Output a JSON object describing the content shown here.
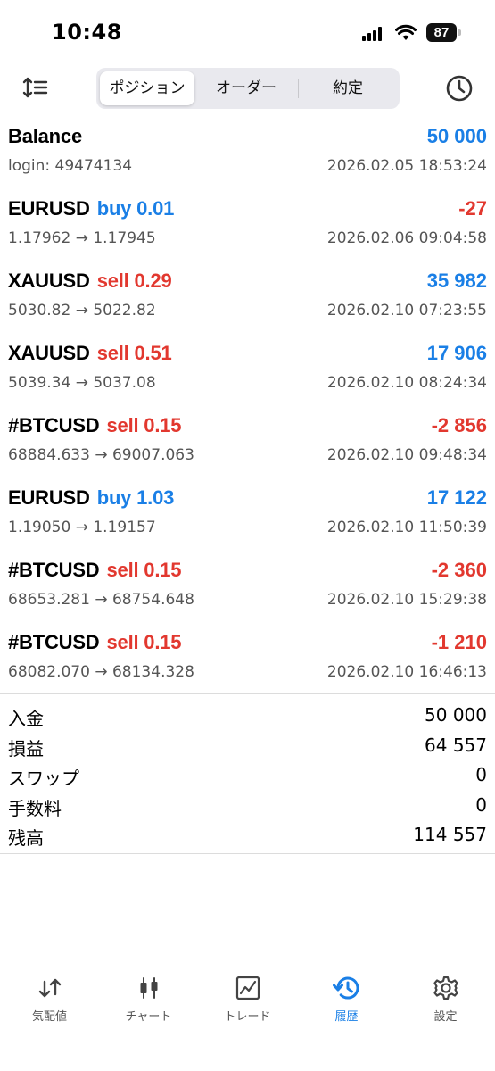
{
  "status_bar": {
    "time": "10:48",
    "battery": "87"
  },
  "toolbar": {
    "tabs": [
      {
        "label": "ポジション",
        "active": true
      },
      {
        "label": "オーダー",
        "active": false
      },
      {
        "label": "約定",
        "active": false
      }
    ]
  },
  "history": [
    {
      "symbol": "Balance",
      "side": "",
      "side_type": "",
      "value": "50 000",
      "value_type": "positive",
      "left_sub": "login: 49474134",
      "time": "2026.02.05 18:53:24"
    },
    {
      "symbol": "EURUSD",
      "side": "buy 0.01",
      "side_type": "buy",
      "value": "-27",
      "value_type": "negative",
      "left_sub": "1.17962 → 1.17945",
      "time": "2026.02.06 09:04:58"
    },
    {
      "symbol": "XAUUSD",
      "side": "sell 0.29",
      "side_type": "sell",
      "value": "35 982",
      "value_type": "positive",
      "left_sub": "5030.82 → 5022.82",
      "time": "2026.02.10 07:23:55"
    },
    {
      "symbol": "XAUUSD",
      "side": "sell 0.51",
      "side_type": "sell",
      "value": "17 906",
      "value_type": "positive",
      "left_sub": "5039.34 → 5037.08",
      "time": "2026.02.10 08:24:34"
    },
    {
      "symbol": "#BTCUSD",
      "side": "sell 0.15",
      "side_type": "sell",
      "value": "-2 856",
      "value_type": "negative",
      "left_sub": "68884.633 → 69007.063",
      "time": "2026.02.10 09:48:34"
    },
    {
      "symbol": "EURUSD",
      "side": "buy 1.03",
      "side_type": "buy",
      "value": "17 122",
      "value_type": "positive",
      "left_sub": "1.19050 → 1.19157",
      "time": "2026.02.10 11:50:39"
    },
    {
      "symbol": "#BTCUSD",
      "side": "sell 0.15",
      "side_type": "sell",
      "value": "-2 360",
      "value_type": "negative",
      "left_sub": "68653.281 → 68754.648",
      "time": "2026.02.10 15:29:38"
    },
    {
      "symbol": "#BTCUSD",
      "side": "sell 0.15",
      "side_type": "sell",
      "value": "-1 210",
      "value_type": "negative",
      "left_sub": "68082.070 → 68134.328",
      "time": "2026.02.10 16:46:13"
    }
  ],
  "summary": [
    {
      "label": "入金",
      "value": "50 000"
    },
    {
      "label": "損益",
      "value": "64 557"
    },
    {
      "label": "スワップ",
      "value": "0"
    },
    {
      "label": "手数料",
      "value": "0"
    },
    {
      "label": "残高",
      "value": "114 557"
    }
  ],
  "tabbar": [
    {
      "label": "気配値",
      "icon": "quotes-icon",
      "active": false
    },
    {
      "label": "チャート",
      "icon": "chart-icon",
      "active": false
    },
    {
      "label": "トレード",
      "icon": "trade-icon",
      "active": false
    },
    {
      "label": "履歴",
      "icon": "history-icon",
      "active": true
    },
    {
      "label": "設定",
      "icon": "settings-icon",
      "active": false
    }
  ],
  "colors": {
    "accent": "#1a7fe6",
    "negative": "#e2382f",
    "sell": "#e2382f",
    "buy": "#1a7fe6"
  }
}
